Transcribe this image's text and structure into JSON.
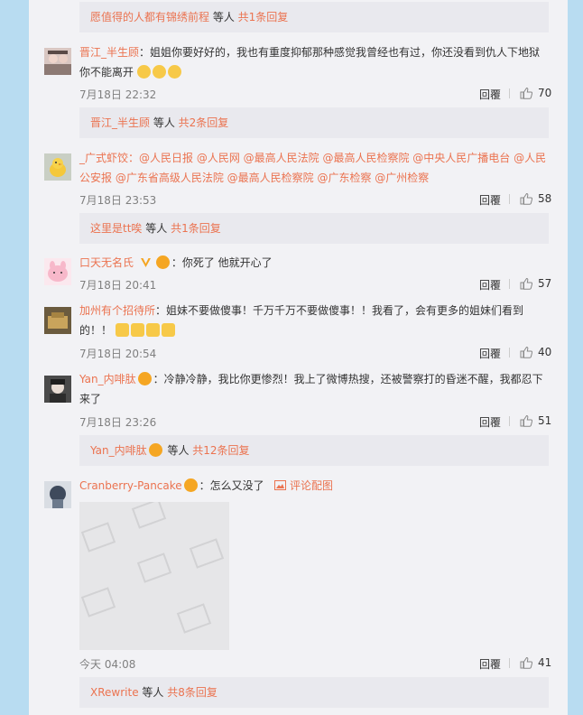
{
  "reply_boxes": [
    {
      "users": "愿值得的人都有锦绣前程",
      "suffix": " 等人 ",
      "count": "共1条回复"
    },
    {
      "users": "晋江_半生顾",
      "suffix": " 等人 ",
      "count": "共2条回复"
    },
    {
      "users": "这里是tt唉",
      "suffix": " 等人 ",
      "count": "共1条回复"
    },
    {
      "users": "Yan_内啡肽",
      "suffix": " 等人 ",
      "count": "共12条回复"
    },
    {
      "users": "XRewrite",
      "suffix": " 等人 ",
      "count": "共8条回复"
    }
  ],
  "comments": [
    {
      "user": "晋江_半生顾",
      "text_1": "：姐姐你要好好的，我也有重度抑郁那种感觉我曾经也有过，你还没看到仇人下地狱",
      "text_2": "你不能离开",
      "time": "7月18日 22:32",
      "reply": "回覆",
      "likes": "70"
    },
    {
      "user": "_广式虾饺",
      "mentions_1": "：@人民日报 @人民网 @最高人民法院 @最高人民检察院 @中央人民广播电台 @人民",
      "mentions_2": "公安报 @广东省高级人民法院 @最高人民检察院 @广东检察 @广州检察",
      "time": "7月18日 23:53",
      "reply": "回覆",
      "likes": "58"
    },
    {
      "user": "口天无名氏",
      "text_1": "：你死了 他就开心了",
      "time": "7月18日 20:41",
      "reply": "回覆",
      "likes": "57"
    },
    {
      "user": "加州有个招待所",
      "text_1": "：姐妹不要做傻事！千万千万不要做傻事！！我看了，会有更多的姐妹们看到",
      "text_2": "的！！",
      "time": "7月18日 20:54",
      "reply": "回覆",
      "likes": "40"
    },
    {
      "user": "Yan_内啡肽",
      "text_1": "：冷静冷静，我比你更惨烈！我上了微博热搜，还被警察打的昏迷不醒，我都忍下",
      "text_2": "来了",
      "time": "7月18日 23:26",
      "reply": "回覆",
      "likes": "51"
    },
    {
      "user": "Cranberry-Pancake",
      "text_1": "：怎么又没了",
      "pic_link": "评论配图",
      "time": "今天 04:08",
      "reply": "回覆",
      "likes": "41"
    }
  ],
  "colors": {
    "accent": "#eb7350",
    "panel": "#f2f2f5",
    "reply_box": "#e9e9ee",
    "page_bg": "#b8dcf1"
  }
}
